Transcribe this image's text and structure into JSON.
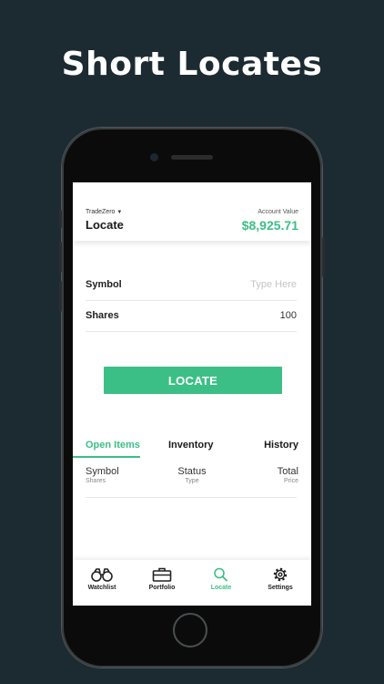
{
  "headline": "Short Locates",
  "header": {
    "broker": "TradeZero",
    "title": "Locate",
    "account_label": "Account Value",
    "account_value": "$8,925.71"
  },
  "form": {
    "symbol_label": "Symbol",
    "symbol_placeholder": "Type Here",
    "shares_label": "Shares",
    "shares_value": "100"
  },
  "locate_button": "LOCATE",
  "tabs": [
    {
      "label": "Open Items",
      "active": true
    },
    {
      "label": "Inventory",
      "active": false
    },
    {
      "label": "History",
      "active": false
    }
  ],
  "columns": [
    {
      "main": "Symbol",
      "sub": "Shares"
    },
    {
      "main": "Status",
      "sub": "Type"
    },
    {
      "main": "Total",
      "sub": "Price"
    }
  ],
  "nav": [
    {
      "label": "Watchlist",
      "icon": "binoculars-icon",
      "active": false
    },
    {
      "label": "Portfolio",
      "icon": "briefcase-icon",
      "active": false
    },
    {
      "label": "Locate",
      "icon": "search-icon",
      "active": true
    },
    {
      "label": "Settings",
      "icon": "gear-icon",
      "active": false
    }
  ],
  "colors": {
    "accent": "#3cbf86",
    "background": "#1c2b31"
  }
}
